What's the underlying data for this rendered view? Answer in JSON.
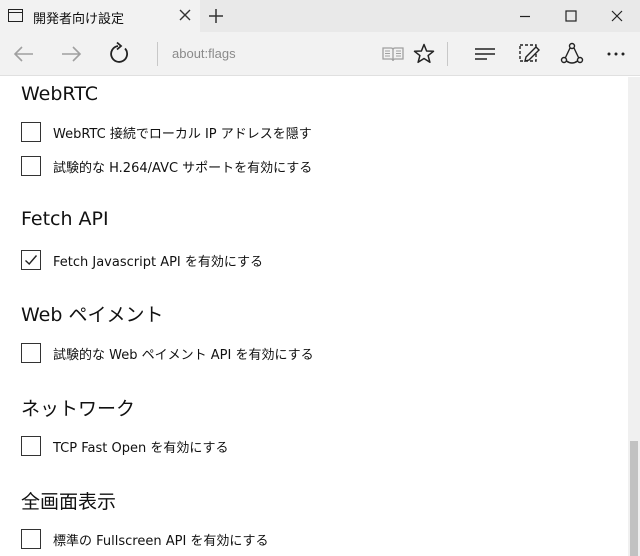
{
  "tab": {
    "title": "開発者向け設定",
    "page_icon": "page-icon",
    "close_icon": "close-icon"
  },
  "window": {
    "new_tab_icon": "plus-icon",
    "minimize_icon": "minimize-icon",
    "maximize_icon": "maximize-icon",
    "close_icon": "close-icon"
  },
  "navbar": {
    "address": "about:flags",
    "icons": [
      "back-arrow-icon",
      "forward-arrow-icon",
      "refresh-icon",
      "reading-view-icon",
      "favorite-star-icon",
      "hub-icon",
      "web-note-icon",
      "share-icon",
      "more-icon"
    ]
  },
  "sections": [
    {
      "title": "WebRTC",
      "options": [
        {
          "label": "WebRTC 接続でローカル IP アドレスを隠す",
          "checked": false
        },
        {
          "label": "試験的な H.264/AVC サポートを有効にする",
          "checked": false
        }
      ]
    },
    {
      "title": "Fetch API",
      "options": [
        {
          "label": "Fetch Javascript API を有効にする",
          "checked": true
        }
      ]
    },
    {
      "title": "Web ペイメント",
      "options": [
        {
          "label": "試験的な Web ペイメント API を有効にする",
          "checked": false
        }
      ]
    },
    {
      "title": "ネットワーク",
      "options": [
        {
          "label": "TCP Fast Open を有効にする",
          "checked": false
        }
      ]
    },
    {
      "title": "全画面表示",
      "options": [
        {
          "label": "標準の Fullscreen API を有効にする",
          "checked": false
        }
      ]
    }
  ],
  "colors": {
    "tabbar": "#e9e9e9",
    "navbar": "#f2f2f2",
    "text": "#111111",
    "address": "#8a8a8a"
  }
}
